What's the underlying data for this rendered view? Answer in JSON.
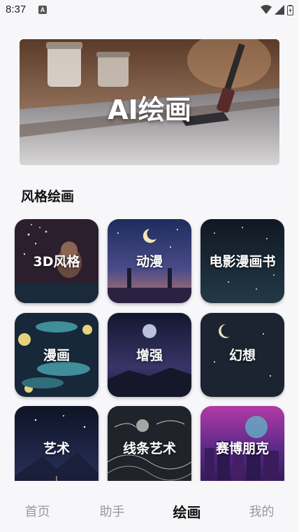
{
  "status_bar": {
    "time": "8:37",
    "notification_icon": "a-icon",
    "notification_letter": "A"
  },
  "hero": {
    "title": "AI绘画"
  },
  "section": {
    "title": "风格绘画"
  },
  "styles": [
    {
      "label": "3D风格"
    },
    {
      "label": "动漫"
    },
    {
      "label": "电影漫画书"
    },
    {
      "label": "漫画"
    },
    {
      "label": "增强"
    },
    {
      "label": "幻想"
    },
    {
      "label": "艺术"
    },
    {
      "label": "线条艺术"
    },
    {
      "label": "赛博朋克"
    }
  ],
  "nav": {
    "items": [
      {
        "label": "首页"
      },
      {
        "label": "助手"
      },
      {
        "label": "绘画"
      },
      {
        "label": "我的"
      }
    ],
    "active": "绘画"
  }
}
